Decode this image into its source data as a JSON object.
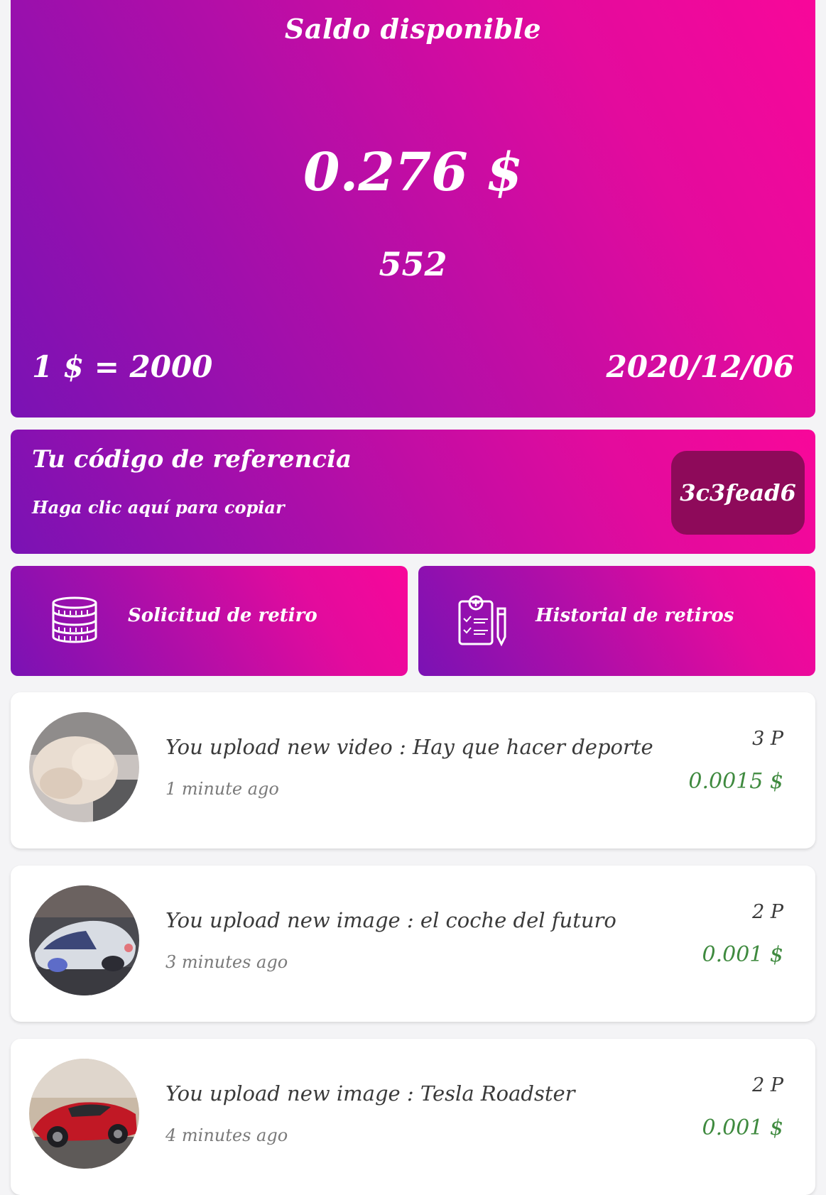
{
  "balance": {
    "title": "Saldo disponible",
    "amount": "0.276 $",
    "points": "552",
    "rate": "1 $ = 2000",
    "date": "2020/12/06"
  },
  "referral": {
    "title": "Tu código de referencia",
    "subtitle": "Haga clic aquí para copiar",
    "code": "3c3fead6"
  },
  "actions": {
    "withdraw_label": "Solicitud de retiro",
    "withdraw_icon": "coins-stack-icon",
    "history_label": "Historial de retiros",
    "history_icon": "clipboard-history-icon"
  },
  "activities": [
    {
      "text": "You upload new video : Hay que hacer deporte",
      "time": "1 minute ago",
      "points": "3 P",
      "usd": "0.0015 $"
    },
    {
      "text": "You upload new image : el coche del futuro",
      "time": "3 minutes ago",
      "points": "2 P",
      "usd": "0.001 $"
    },
    {
      "text": "You upload new image : Tesla Roadster",
      "time": "4 minutes ago",
      "points": "2 P",
      "usd": "0.001 $"
    }
  ],
  "colors": {
    "gradient_start": "#7a12b4",
    "gradient_end": "#f8079a",
    "code_badge": "#8e0a5a",
    "usd_green": "#3f8a3f"
  }
}
